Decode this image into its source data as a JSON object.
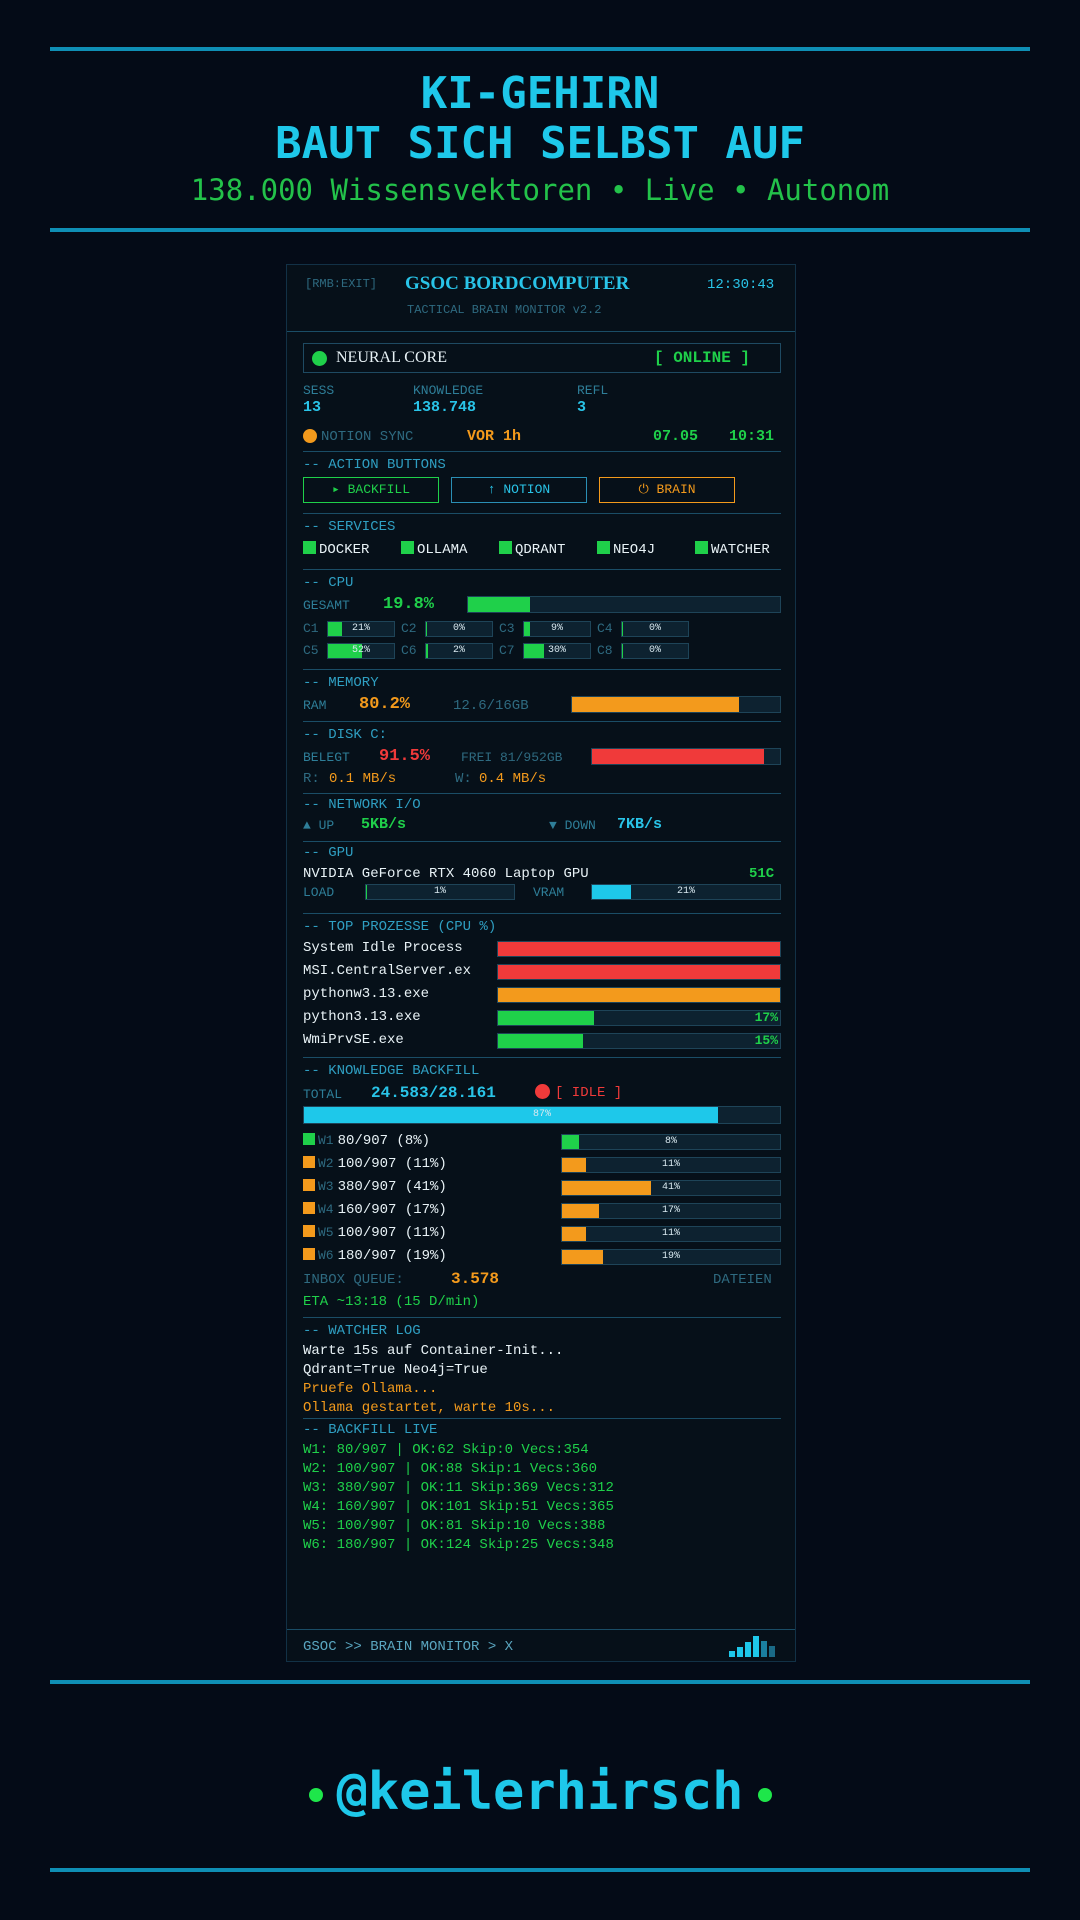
{
  "header": {
    "title_line1": "KI-GEHIRN",
    "title_line2": "BAUT SICH SELBST AUF",
    "subtitle": "138.000 Wissensvektoren • Live • Autonom"
  },
  "footer": {
    "handle": "@keilerhirsch"
  },
  "panel": {
    "exit_hint": "[RMB:EXIT]",
    "title": "GSOC  BORDCOMPUTER",
    "time": "12:30:43",
    "subtitle": "TACTICAL BRAIN MONITOR  v2.2",
    "core": {
      "label": "NEURAL CORE",
      "status": "[ ONLINE ]"
    },
    "stats": {
      "sess_label": "SESS",
      "sess_value": "13",
      "knowledge_label": "KNOWLEDGE",
      "knowledge_value": "138.748",
      "refl_label": "REFL",
      "refl_value": "3"
    },
    "notion": {
      "label": "NOTION SYNC",
      "age": "VOR 1h",
      "date": "07.05",
      "time": "10:31"
    },
    "actions": {
      "section": "-- ACTION BUTTONS",
      "backfill": "▸ BACKFILL",
      "notion": "↑ NOTION",
      "brain": "⏻ BRAIN"
    },
    "services": {
      "section": "-- SERVICES",
      "items": [
        "DOCKER",
        "OLLAMA",
        "QDRANT",
        "NEO4J",
        "WATCHER"
      ]
    },
    "cpu": {
      "section": "-- CPU",
      "total_label": "GESAMT",
      "total_value": "19.8%",
      "total_fraction": 0.198,
      "cores": [
        {
          "label": "C1",
          "text": "21%",
          "value": 21
        },
        {
          "label": "C2",
          "text": "0%",
          "value": 0
        },
        {
          "label": "C3",
          "text": "9%",
          "value": 9
        },
        {
          "label": "C4",
          "text": "0%",
          "value": 0
        },
        {
          "label": "C5",
          "text": "52%",
          "value": 52
        },
        {
          "label": "C6",
          "text": "2%",
          "value": 2
        },
        {
          "label": "C7",
          "text": "30%",
          "value": 30
        },
        {
          "label": "C8",
          "text": "0%",
          "value": 0
        }
      ]
    },
    "memory": {
      "section": "-- MEMORY",
      "label": "RAM",
      "value": "80.2%",
      "detail": "12.6/16GB",
      "fraction": 0.802
    },
    "disk": {
      "section": "-- DISK  C:",
      "label": "BELEGT",
      "value": "91.5%",
      "free": "FREI 81/952GB",
      "fraction": 0.915,
      "read_label": "R:",
      "read_value": "0.1 MB/s",
      "write_label": "W:",
      "write_value": "0.4 MB/s"
    },
    "network": {
      "section": "-- NETWORK  I/O",
      "up_label": "▲ UP",
      "up_value": "5KB/s",
      "down_label": "▼ DOWN",
      "down_value": "7KB/s"
    },
    "gpu": {
      "section": "-- GPU",
      "name": "NVIDIA GeForce RTX 4060 Laptop GPU",
      "temp": "51C",
      "load_label": "LOAD",
      "load_text": "1%",
      "load_fraction": 0.01,
      "vram_label": "VRAM",
      "vram_text": "21%",
      "vram_fraction": 0.21
    },
    "processes": {
      "section": "-- TOP PROZESSE  (CPU %)",
      "items": [
        {
          "name": "System Idle Process",
          "text": "",
          "fraction": 1.0,
          "color": "#f03a3a"
        },
        {
          "name": "MSI.CentralServer.ex",
          "text": "",
          "fraction": 1.0,
          "color": "#f03a3a"
        },
        {
          "name": "pythonw3.13.exe",
          "text": "",
          "fraction": 1.0,
          "color": "#f39a1c"
        },
        {
          "name": "python3.13.exe",
          "text": "17%",
          "fraction": 0.34,
          "color": "#1fd04a"
        },
        {
          "name": "WmiPrvSE.exe",
          "text": "15%",
          "fraction": 0.3,
          "color": "#1fd04a"
        }
      ]
    },
    "backfill": {
      "section": "-- KNOWLEDGE BACKFILL",
      "total_label": "TOTAL",
      "total_value": "24.583/28.161",
      "status": "[ IDLE ]",
      "total_text": "87%",
      "total_fraction": 0.87,
      "workers": [
        {
          "label": "W1",
          "text": "80/907 (8%)",
          "bar_text": "8%",
          "fraction": 0.08,
          "color": "#1fd04a"
        },
        {
          "label": "W2",
          "text": "100/907 (11%)",
          "bar_text": "11%",
          "fraction": 0.11,
          "color": "#f39a1c"
        },
        {
          "label": "W3",
          "text": "380/907 (41%)",
          "bar_text": "41%",
          "fraction": 0.41,
          "color": "#f39a1c"
        },
        {
          "label": "W4",
          "text": "160/907 (17%)",
          "bar_text": "17%",
          "fraction": 0.17,
          "color": "#f39a1c"
        },
        {
          "label": "W5",
          "text": "100/907 (11%)",
          "bar_text": "11%",
          "fraction": 0.11,
          "color": "#f39a1c"
        },
        {
          "label": "W6",
          "text": "180/907 (19%)",
          "bar_text": "19%",
          "fraction": 0.19,
          "color": "#f39a1c"
        }
      ],
      "queue_label": "INBOX QUEUE:",
      "queue_value": "3.578",
      "queue_unit": "DATEIEN",
      "eta": "ETA ~13:18  (15 D/min)"
    },
    "watcher": {
      "section": "-- WATCHER LOG",
      "lines": [
        {
          "text": "Warte 15s auf Container-Init...",
          "color": "#e8f2f6"
        },
        {
          "text": "Qdrant=True Neo4j=True",
          "color": "#e8f2f6"
        },
        {
          "text": "Pruefe Ollama...",
          "color": "#f39a1c"
        },
        {
          "text": "Ollama gestartet, warte 10s...",
          "color": "#f39a1c"
        }
      ]
    },
    "live": {
      "section": "-- BACKFILL LIVE",
      "lines": [
        "W1: 80/907 | OK:62 Skip:0 Vecs:354",
        "W2: 100/907 | OK:88 Skip:1 Vecs:360",
        "W3: 380/907 | OK:11 Skip:369 Vecs:312",
        "W4: 160/907 | OK:101 Skip:51 Vecs:365",
        "W5: 100/907 | OK:81 Skip:10 Vecs:388",
        "W6: 180/907 | OK:124 Skip:25 Vecs:348"
      ]
    },
    "prompt": "GSOC >> BRAIN MONITOR > X",
    "colors": {
      "accent": "#29c4e8",
      "ok": "#1fd04a",
      "warn": "#f39a1c",
      "crit": "#f03a3a"
    }
  }
}
